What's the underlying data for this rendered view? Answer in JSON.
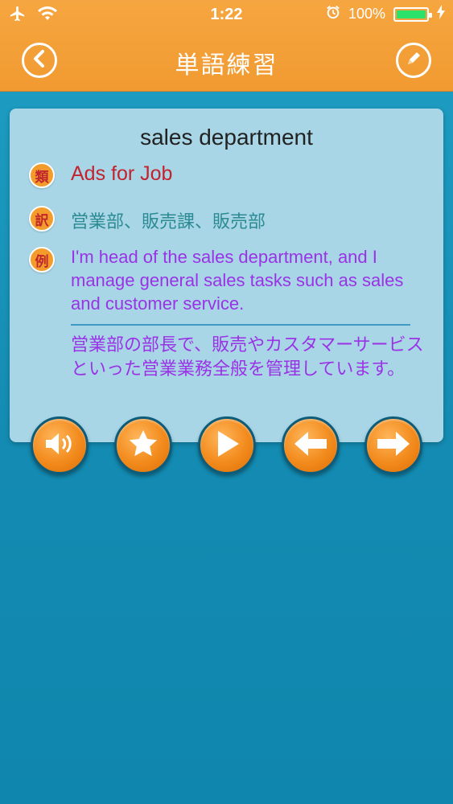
{
  "status_bar": {
    "time": "1:22",
    "battery_percent": "100%",
    "battery_level": 1.0,
    "icons": [
      "airplane-icon",
      "wifi-icon",
      "alarm-icon",
      "battery-icon",
      "charging-icon"
    ]
  },
  "nav": {
    "title": "単語練習",
    "left_icon": "back-icon",
    "right_icon": "edit-icon"
  },
  "card": {
    "word": "sales department",
    "related_badge": "類",
    "related": "Ads for Job",
    "translation_badge": "訳",
    "translation": "営業部、販売課、販売部",
    "example_badge": "例",
    "example_en": "I'm head of the sales department, and I manage general sales tasks such as sales and customer service.",
    "example_ja": "営業部の部長で、販売やカスタマーサービスといった営業業務全般を管理しています。"
  },
  "actions": [
    {
      "name": "speaker",
      "icon": "speaker-icon"
    },
    {
      "name": "favorite",
      "icon": "star-icon"
    },
    {
      "name": "play",
      "icon": "play-icon"
    },
    {
      "name": "previous",
      "icon": "arrow-left-icon"
    },
    {
      "name": "next",
      "icon": "arrow-right-icon"
    }
  ],
  "colors": {
    "accent_orange": "#f19a31",
    "background_blue": "#148bb2",
    "card_bg": "#a8d6e6",
    "related_text": "#c3232e",
    "translation_text": "#2c8a93",
    "example_text": "#9a33e6"
  }
}
